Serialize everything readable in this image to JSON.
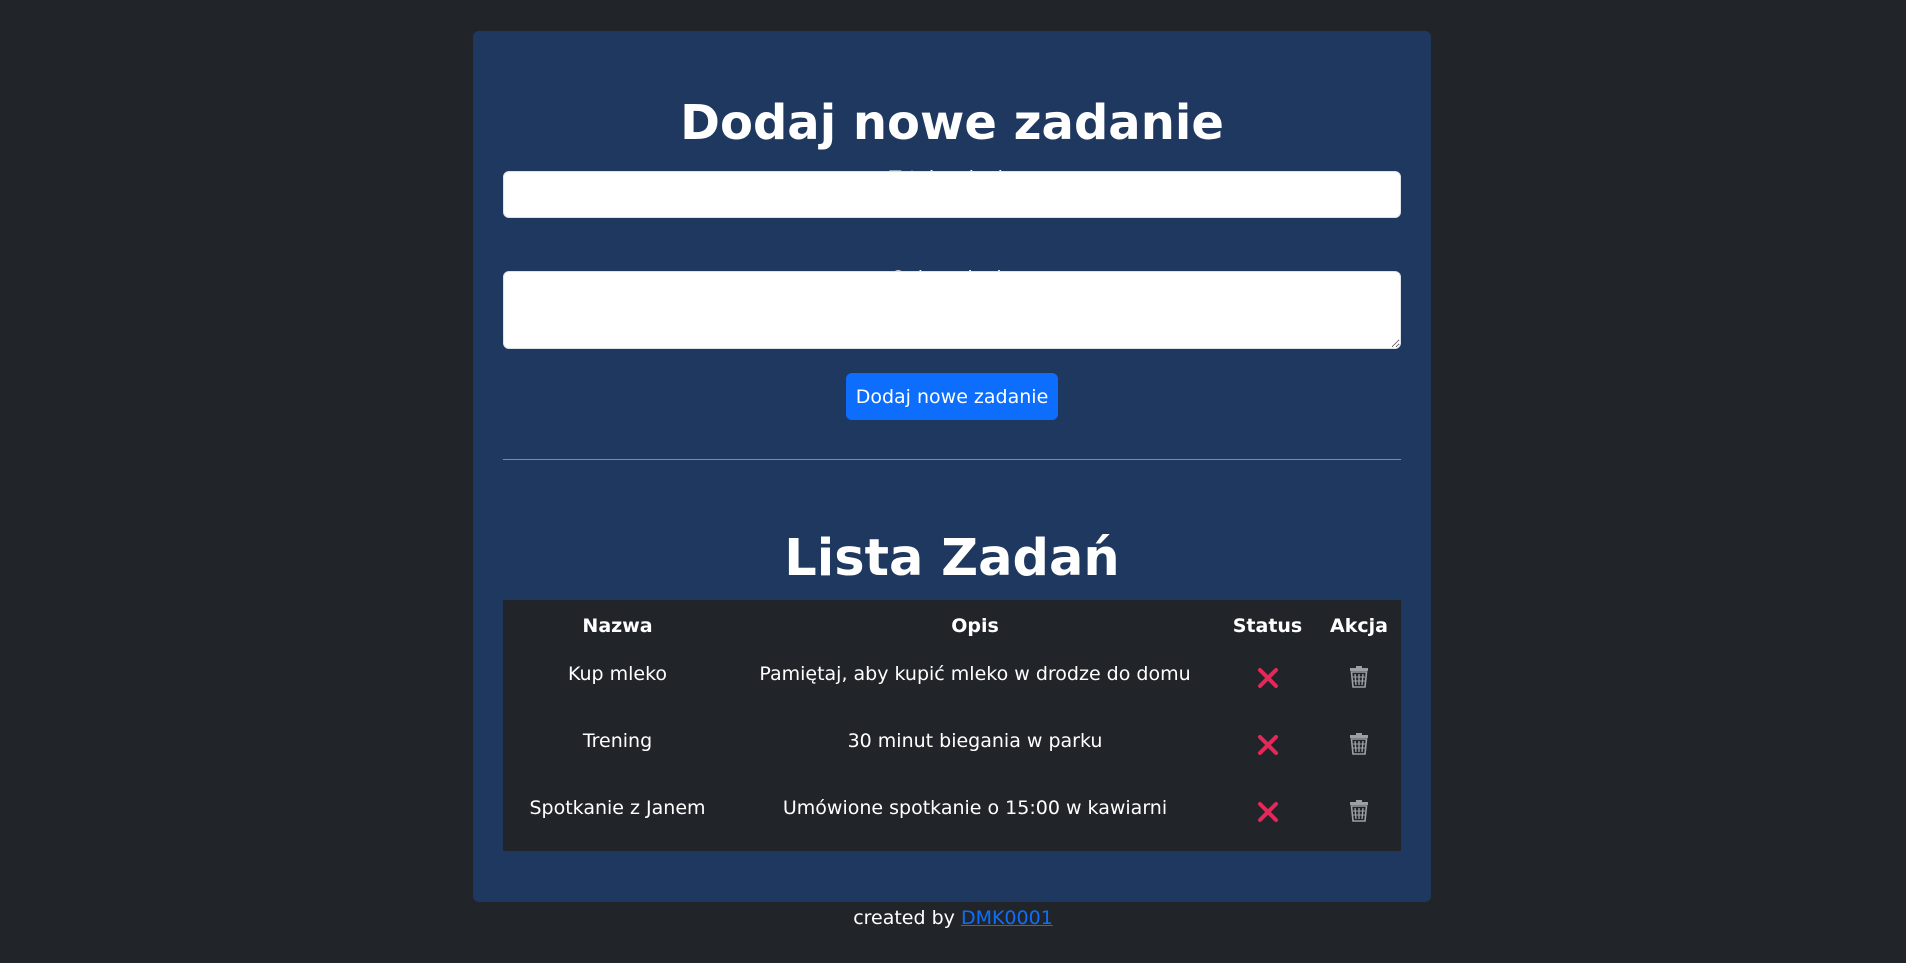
{
  "form": {
    "heading": "Dodaj nowe zadanie",
    "title_label": "Tytuł zadania",
    "title_value": "",
    "description_label": "Opis zadania",
    "description_value": "",
    "submit_label": "Dodaj nowe zadanie"
  },
  "list": {
    "heading": "Lista Zadań",
    "columns": [
      "Nazwa",
      "Opis",
      "Status",
      "Akcja"
    ],
    "rows": [
      {
        "name": "Kup mleko",
        "description": "Pamiętaj, aby kupić mleko w drodze do domu",
        "status_icon": "x-icon",
        "action_icon": "trash-icon"
      },
      {
        "name": "Trening",
        "description": "30 minut biegania w parku",
        "status_icon": "x-icon",
        "action_icon": "trash-icon"
      },
      {
        "name": "Spotkanie z Janem",
        "description": "Umówione spotkanie o 15:00 w kawiarni",
        "status_icon": "x-icon",
        "action_icon": "trash-icon"
      }
    ]
  },
  "footer": {
    "prefix": "created by",
    "link_label": "DMK0001"
  },
  "colors": {
    "page_background": "#212529",
    "card_background": "#1f3860",
    "primary": "#0d6efd",
    "status_incomplete": "#e5285a",
    "trash": "#9aa0a6"
  }
}
